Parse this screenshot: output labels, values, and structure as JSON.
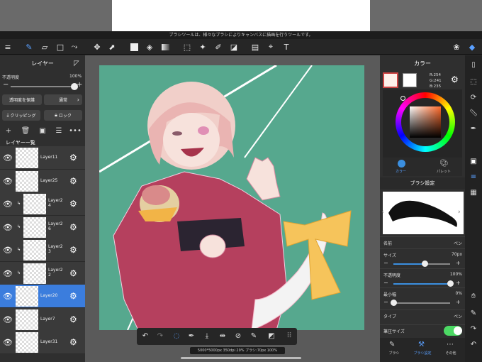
{
  "hint": "ブラシツールは、様々なブラシによりキャンバスに描画を行うツールです。",
  "toolbar": {
    "icons": [
      "menu-icon",
      "brush-tool-icon",
      "eraser-icon",
      "shape-icon",
      "selection-pen-icon",
      "move-icon",
      "transform-icon",
      "fill-color-icon",
      "bucket-icon",
      "gradient-icon",
      "select-rect-icon",
      "magic-wand-icon",
      "select-pen-icon",
      "select-eraser-icon",
      "frame-icon",
      "snap-icon",
      "text-icon",
      "materials-icon",
      "layers-icon"
    ]
  },
  "layers_panel": {
    "title": "レイヤー",
    "opacity_label": "不透明度",
    "opacity_value": "100%",
    "opacity": 1.0,
    "protect_alpha": "透明度を保護",
    "blend_mode": "通常",
    "clipping": "クリッピング",
    "lock": "ロック",
    "list_label": "レイヤー一覧",
    "layers": [
      {
        "name": "Layer11",
        "clipped": false,
        "active": false
      },
      {
        "name": "Layer25",
        "clipped": false,
        "active": false
      },
      {
        "name": "Layer2\n4",
        "clipped": true,
        "active": false
      },
      {
        "name": "Layer2\n6",
        "clipped": true,
        "active": false
      },
      {
        "name": "Layer2\n3",
        "clipped": true,
        "active": false
      },
      {
        "name": "Layer2\n2",
        "clipped": true,
        "active": false
      },
      {
        "name": "Layer20",
        "clipped": false,
        "active": true
      },
      {
        "name": "Layer7",
        "clipped": false,
        "active": false
      },
      {
        "name": "Layer31",
        "clipped": false,
        "active": false
      }
    ]
  },
  "color_panel": {
    "title": "カラー",
    "r": "R:254",
    "g": "G:241",
    "b": "B:235",
    "main_color": "#fef1eb",
    "tab_color": "カラー",
    "tab_palette": "パレット"
  },
  "brush_panel": {
    "title": "ブラシ設定",
    "name_label": "名前",
    "name_value": "ペン",
    "size_label": "サイズ",
    "size_value": "70px",
    "size_level": 0.55,
    "opacity_label": "不透明度",
    "opacity_value": "100%",
    "opacity_level": 1.0,
    "min_width_label": "最小幅",
    "min_width_value": "0%",
    "min_width_level": 0.0,
    "type_label": "タイプ",
    "type_value": "ペン",
    "pressure_label": "筆圧サイズ",
    "pressure_on": true
  },
  "bottom_tabs": [
    "ブラシ",
    "ブラシ設定",
    "その他"
  ],
  "status": "5000*5000px 350dpi 29% ブラシ:70px 100%",
  "accent": "#3b7ddd"
}
